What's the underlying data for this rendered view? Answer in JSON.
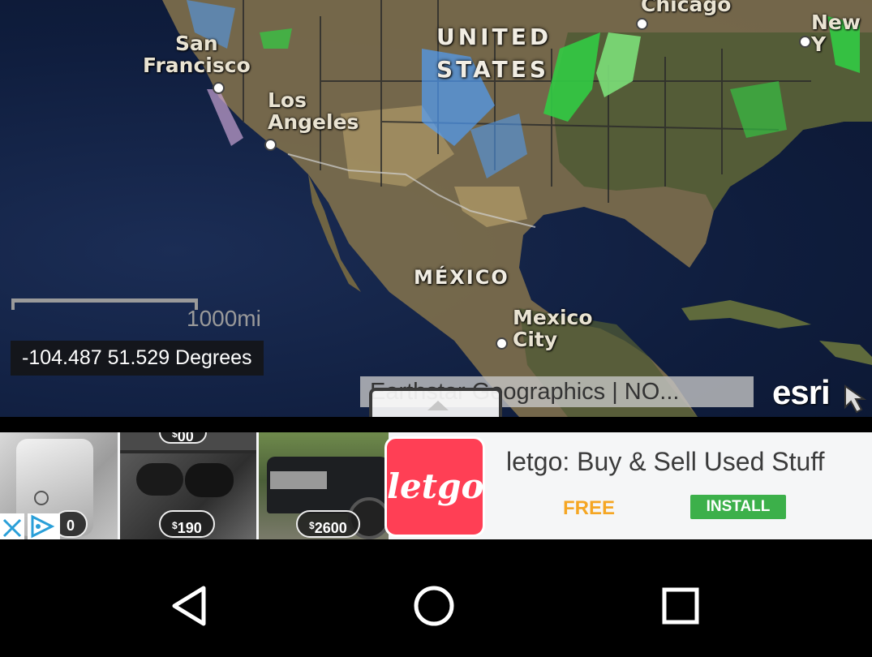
{
  "map": {
    "labels": {
      "san_francisco": "San\nFrancisco",
      "los_angeles": "Los\nAngeles",
      "chicago": "Chicago",
      "new_york": "New Y",
      "united_states": "UNITED\nSTATES",
      "mexico": "MÉXICO",
      "mexico_city": "Mexico\nCity"
    },
    "scale_label": "1000mi",
    "coordinates": "-104.487 51.529 Degrees",
    "attribution": "Earthstar Geographics | NO...",
    "esri_logo": "esri",
    "colors": {
      "ocean": "#13254a",
      "land": "#8a7a55",
      "radar_green": "#33cc44",
      "radar_blue": "#4fa0ff"
    }
  },
  "ad": {
    "prices": [
      "0",
      "190",
      "2600"
    ],
    "price_partial_top": "00",
    "currency": "$",
    "logo_text": "letgo",
    "title": "letgo: Buy & Sell Used Stuff",
    "free_label": "FREE",
    "install_label": "INSTALL",
    "colors": {
      "brand": "#ff3f55",
      "install": "#3cb04a",
      "free": "#f5a623"
    }
  },
  "navbar": {
    "back_icon": "back-triangle-icon",
    "home_icon": "home-circle-icon",
    "recents_icon": "recents-square-icon"
  }
}
